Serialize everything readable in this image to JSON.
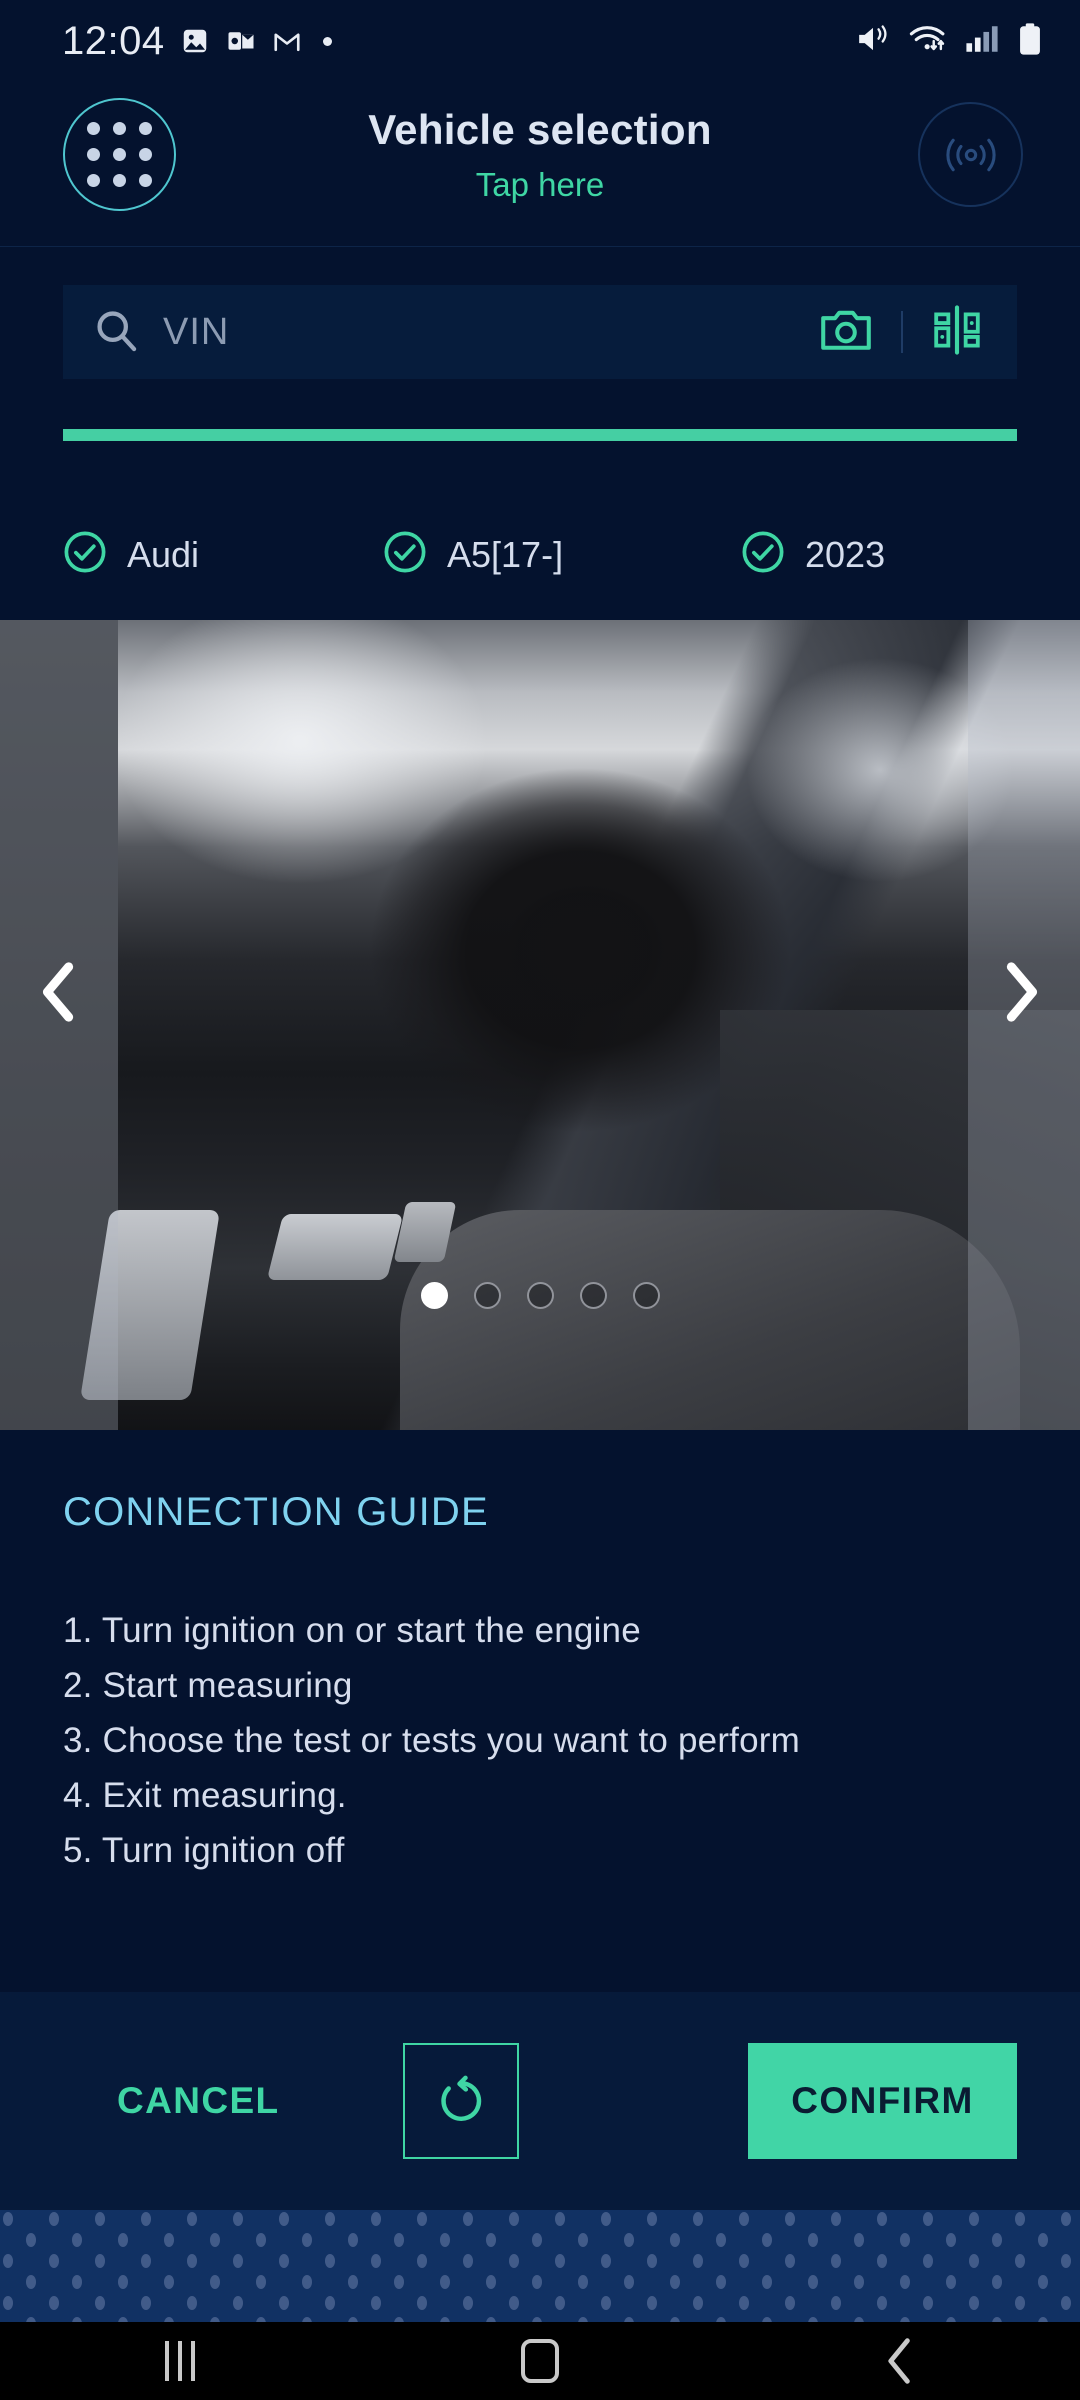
{
  "status_bar": {
    "time": "12:04",
    "left_icons": [
      "gallery-icon",
      "outlook-icon",
      "gmail-icon",
      "notification-dot"
    ],
    "right_icons": [
      "mute-vibrate-icon",
      "wifi-icon",
      "cellular-signal-icon",
      "battery-icon"
    ]
  },
  "header": {
    "menu_icon": "grid-menu-icon",
    "title": "Vehicle selection",
    "subtitle": "Tap here",
    "connect_icon": "wireless-connect-icon"
  },
  "search": {
    "icon": "search-icon",
    "placeholder": "VIN",
    "value": "",
    "camera_icon": "camera-icon",
    "barcode_icon": "barcode-scan-icon",
    "progress_percent": 100
  },
  "vehicle_tags": [
    {
      "icon": "check-circle-icon",
      "label": "Audi"
    },
    {
      "icon": "check-circle-icon",
      "label": "A5[17-]"
    },
    {
      "icon": "check-circle-icon",
      "label": "2023"
    }
  ],
  "carousel": {
    "prev_icon": "chevron-left-icon",
    "next_icon": "chevron-right-icon",
    "total_slides": 5,
    "active_slide": 1,
    "image_alt": "car-interior-dashboard-steering-wheel"
  },
  "guide": {
    "title": "CONNECTION GUIDE",
    "steps": [
      "1. Turn ignition on or start the engine",
      "2. Start measuring",
      "3. Choose the test or tests you want to perform",
      "4. Exit measuring.",
      "5. Turn ignition off"
    ]
  },
  "actions": {
    "cancel_label": "CANCEL",
    "refresh_icon": "refresh-icon",
    "confirm_label": "CONFIRM"
  },
  "nav_bar": {
    "recents_icon": "recents-icon",
    "home_icon": "home-icon",
    "back_icon": "back-icon"
  },
  "colors": {
    "background": "#04122e",
    "surface": "#061c3c",
    "accent_teal": "#3fd6a4",
    "accent_cyan": "#4fc6cf",
    "guide_title": "#7fd2ef",
    "text_primary": "#d6dded",
    "text_muted": "#8c9bb2",
    "confirm_bg": "#41d5a6",
    "footer_dots": "#113163"
  }
}
